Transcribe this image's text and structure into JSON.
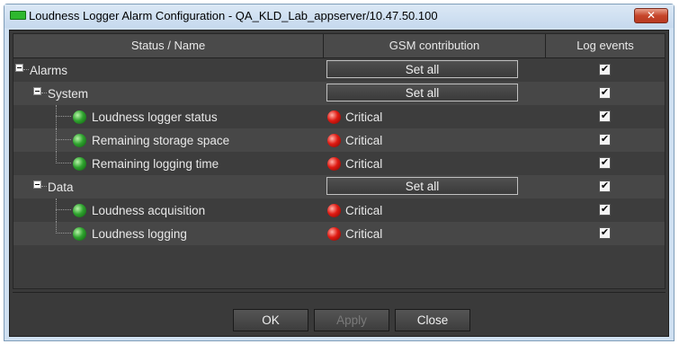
{
  "window": {
    "title": "Loudness Logger Alarm Configuration - QA_KLD_Lab_appserver/10.47.50.100",
    "close_label": "✕"
  },
  "table": {
    "headers": {
      "name": "Status / Name",
      "gsm": "GSM contribution",
      "log": "Log events"
    },
    "rows": [
      {
        "name": "Alarms",
        "gsm_button": "Set all",
        "log_checked": true
      },
      {
        "name": "System",
        "gsm_button": "Set all",
        "log_checked": true
      },
      {
        "name": "Loudness logger status",
        "status": "Critical",
        "log_checked": true
      },
      {
        "name": "Remaining storage space",
        "status": "Critical",
        "log_checked": true
      },
      {
        "name": "Remaining logging time",
        "status": "Critical",
        "log_checked": true
      },
      {
        "name": "Data",
        "gsm_button": "Set all",
        "log_checked": true
      },
      {
        "name": "Loudness acquisition",
        "status": "Critical",
        "log_checked": true
      },
      {
        "name": "Loudness logging",
        "status": "Critical",
        "log_checked": true
      }
    ],
    "checkmark": "✔"
  },
  "buttons": {
    "ok": "OK",
    "apply": "Apply",
    "close": "Close"
  },
  "colors": {
    "ok_led": "#2fa32f",
    "critical_led": "#e01a12",
    "title_icon": "#2eb82e"
  },
  "icons": {
    "title": "green-rectangle-icon",
    "expander": "minus-box-icon",
    "status_ok": "green-led-icon",
    "status_critical": "red-led-icon"
  }
}
